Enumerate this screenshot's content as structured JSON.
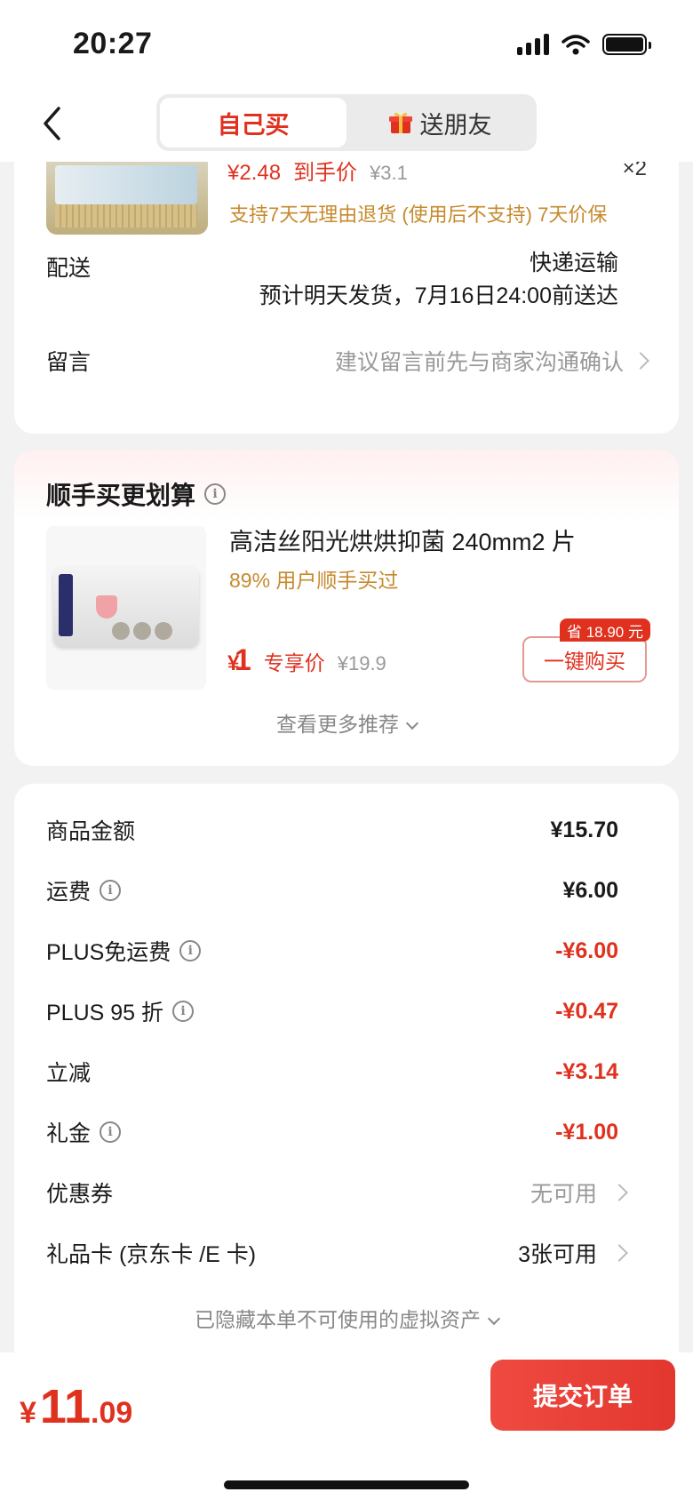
{
  "status_bar": {
    "time": "20:27"
  },
  "nav": {
    "tabs": [
      {
        "label": "自己买",
        "active": true
      },
      {
        "label": "送朋友",
        "active": false,
        "icon": "gift-icon"
      }
    ]
  },
  "order_item": {
    "price": "¥2.48",
    "price_tag": "到手价",
    "original_price": "¥3.1",
    "quantity": "×2",
    "policy": "支持7天无理由退货 (使用后不支持)  7天价保"
  },
  "delivery": {
    "label": "配送",
    "method": "快递运输",
    "eta": "预计明天发货，7月16日24:00前送达"
  },
  "message": {
    "label": "留言",
    "placeholder": "建议留言前先与商家沟通确认"
  },
  "recommend": {
    "title": "顺手买更划算",
    "product_name": "高洁丝阳光烘烘抑菌 240mm2 片",
    "social_proof": "89% 用户顺手买过",
    "price_yen": "¥",
    "price_value": "1",
    "price_tag": "专享价",
    "original_price": "¥19.9",
    "save_badge": "省 18.90 元",
    "buy_button": "一键购买",
    "more_link": "查看更多推荐"
  },
  "fees": [
    {
      "label": "商品金额",
      "value": "¥15.70",
      "info": false,
      "red": false
    },
    {
      "label": "运费",
      "value": "¥6.00",
      "info": true,
      "red": false
    },
    {
      "label": "PLUS免运费",
      "value": "-¥6.00",
      "info": true,
      "red": true
    },
    {
      "label": "PLUS 95 折",
      "value": "-¥0.47",
      "info": true,
      "red": true
    },
    {
      "label": "立减",
      "value": "-¥3.14",
      "info": false,
      "red": true
    },
    {
      "label": "礼金",
      "value": "-¥1.00",
      "info": true,
      "red": true
    }
  ],
  "coupon": {
    "label": "优惠券",
    "value": "无可用"
  },
  "gift_card": {
    "label": "礼品卡 (京东卡 /E 卡)",
    "value": "3张可用"
  },
  "hidden_assets": "已隐藏本单不可使用的虚拟资产",
  "footer": {
    "total_yen": "¥",
    "total_int": "11",
    "total_dec": ".09",
    "submit": "提交订单"
  },
  "colors": {
    "accent": "#e0311f",
    "gold": "#c68a2e"
  }
}
